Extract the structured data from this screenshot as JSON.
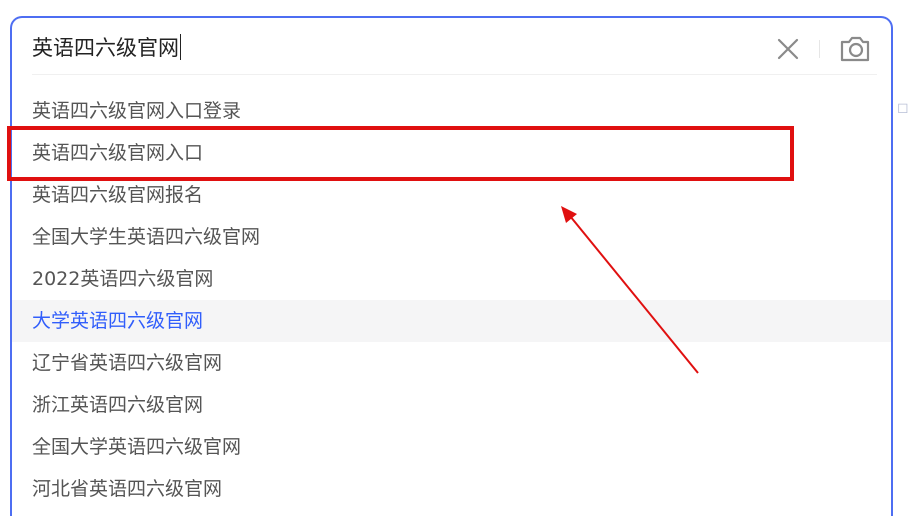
{
  "search": {
    "query": "英语四六级官网",
    "clear_icon": "close-icon",
    "camera_icon": "camera-icon"
  },
  "suggestions": [
    {
      "label": "英语四六级官网入口登录"
    },
    {
      "label": "英语四六级官网入口"
    },
    {
      "label": "英语四六级官网报名"
    },
    {
      "label": "全国大学生英语四六级官网"
    },
    {
      "label": "2022英语四六级官网"
    },
    {
      "label": "大学英语四六级官网"
    },
    {
      "label": "辽宁省英语四六级官网"
    },
    {
      "label": "浙江英语四六级官网"
    },
    {
      "label": "全国大学英语四六级官网"
    },
    {
      "label": "河北省英语四六级官网"
    }
  ],
  "hovered_index": 5,
  "highlighted_index": 1,
  "colors": {
    "border_accent": "#4e6ef2",
    "hover_text": "#315efb",
    "annotation_red": "#e01010"
  }
}
